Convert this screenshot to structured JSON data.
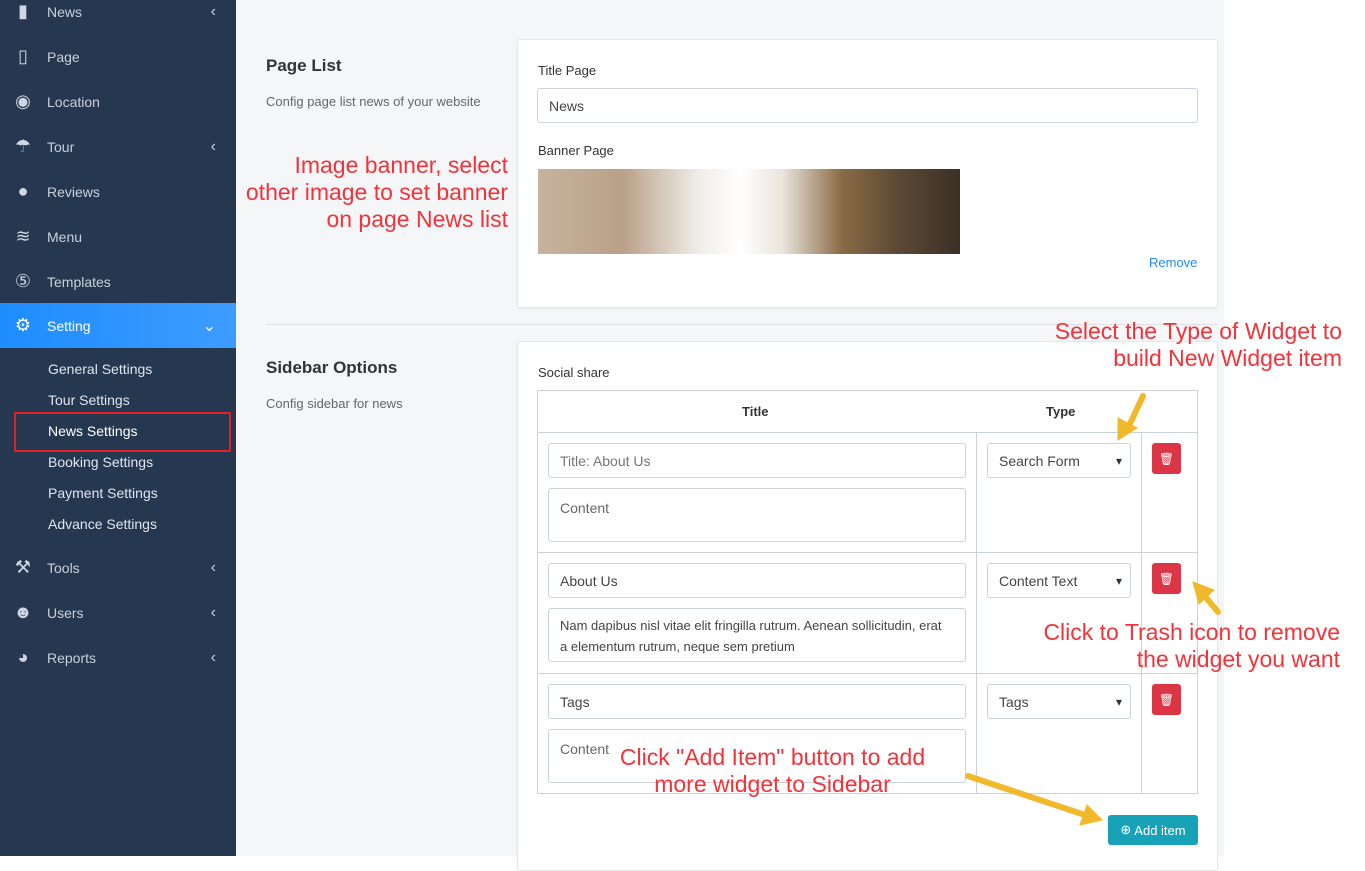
{
  "sidebar": {
    "items": [
      {
        "label": "News",
        "icon": "book-icon",
        "chevron": "‹"
      },
      {
        "label": "Page",
        "icon": "page-icon"
      },
      {
        "label": "Location",
        "icon": "compass-icon"
      },
      {
        "label": "Tour",
        "icon": "umbrella-icon",
        "chevron": "‹"
      },
      {
        "label": "Reviews",
        "icon": "comment-icon"
      },
      {
        "label": "Menu",
        "icon": "layers-icon"
      },
      {
        "label": "Templates",
        "icon": "html5-icon"
      },
      {
        "label": "Setting",
        "icon": "gear-icon",
        "chevron": "⌄"
      },
      {
        "label": "Tools",
        "icon": "hammer-icon",
        "chevron": "‹"
      },
      {
        "label": "Users",
        "icon": "users-icon",
        "chevron": "‹"
      },
      {
        "label": "Reports",
        "icon": "pie-chart-icon",
        "chevron": "‹"
      }
    ],
    "subitems": [
      "General Settings",
      "Tour Settings",
      "News Settings",
      "Booking Settings",
      "Payment Settings",
      "Advance Settings"
    ]
  },
  "page_list": {
    "title": "Page List",
    "description": "Config page list news of your website",
    "title_page_label": "Title Page",
    "title_page_value": "News",
    "banner_label": "Banner Page",
    "remove_label": "Remove"
  },
  "sidebar_options": {
    "title": "Sidebar Options",
    "description": "Config sidebar for news",
    "social_share_label": "Social share",
    "columns": [
      "Title",
      "Type"
    ],
    "rows": [
      {
        "title_placeholder": "Title: About Us",
        "title_value": "",
        "content_placeholder": "Content",
        "content_value": "",
        "type": "Search Form"
      },
      {
        "title_placeholder": "",
        "title_value": "About Us",
        "content_placeholder": "",
        "content_value": "Nam dapibus nisl vitae elit fringilla rutrum. Aenean sollicitudin, erat a elementum rutrum, neque sem pretium",
        "type": "Content Text"
      },
      {
        "title_placeholder": "",
        "title_value": "Tags",
        "content_placeholder": "Content",
        "content_value": "",
        "type": "Tags"
      }
    ],
    "add_item_label": "Add item"
  },
  "annotations": {
    "banner": "Image banner, select other image to set banner on page News list",
    "type": "Select the Type of Widget to build  New Widget item",
    "trash": "Click to Trash icon to remove the widget  you want",
    "add": "Click  \"Add Item\" button to  add more widget to Sidebar"
  },
  "colors": {
    "sidebar": "#263850",
    "active": "#1e8cff",
    "danger": "#dc3545",
    "info": "#17a2b8",
    "annotation": "#f2333a",
    "arrow": "#f0b82a"
  }
}
